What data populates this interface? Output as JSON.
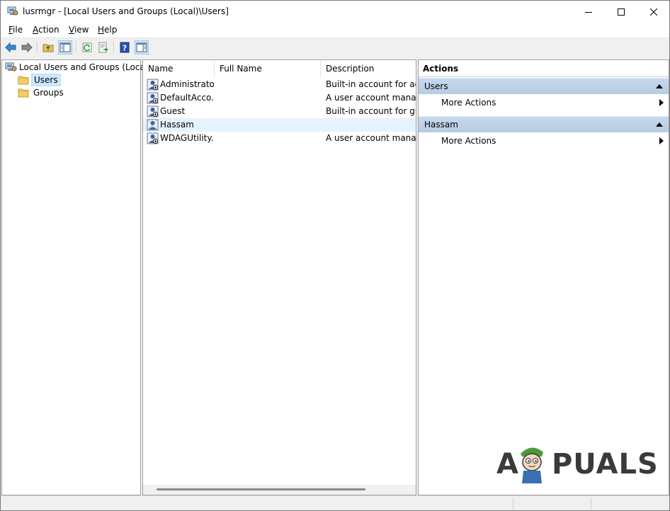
{
  "window": {
    "title": "lusrmgr - [Local Users and Groups (Local)\\Users]"
  },
  "menu": {
    "items": [
      {
        "underline": "F",
        "rest": "ile"
      },
      {
        "underline": "A",
        "rest": "ction"
      },
      {
        "underline": "V",
        "rest": "iew"
      },
      {
        "underline": "H",
        "rest": "elp"
      }
    ]
  },
  "tree": {
    "root": "Local Users and Groups (Local)",
    "children": [
      "Users",
      "Groups"
    ],
    "selected": "Users"
  },
  "list": {
    "columns": [
      "Name",
      "Full Name",
      "Description"
    ],
    "rows": [
      {
        "name": "Administrator",
        "full_name": "",
        "description": "Built-in account for adm"
      },
      {
        "name": "DefaultAcco...",
        "full_name": "",
        "description": "A user account manage"
      },
      {
        "name": "Guest",
        "full_name": "",
        "description": "Built-in account for gue"
      },
      {
        "name": "Hassam",
        "full_name": "",
        "description": ""
      },
      {
        "name": "WDAGUtility...",
        "full_name": "",
        "description": "A user account manage"
      }
    ],
    "highlighted_row": "Hassam"
  },
  "actions": {
    "title": "Actions",
    "sections": [
      {
        "header": "Users",
        "item": "More Actions"
      },
      {
        "header": "Hassam",
        "item": "More Actions"
      }
    ]
  },
  "watermark": {
    "first": "A",
    "rest": "PUALS"
  },
  "colors": {
    "section_header": "#bcd0e6",
    "selection": "#cce8ff",
    "row_hover": "#e5f3ff"
  }
}
